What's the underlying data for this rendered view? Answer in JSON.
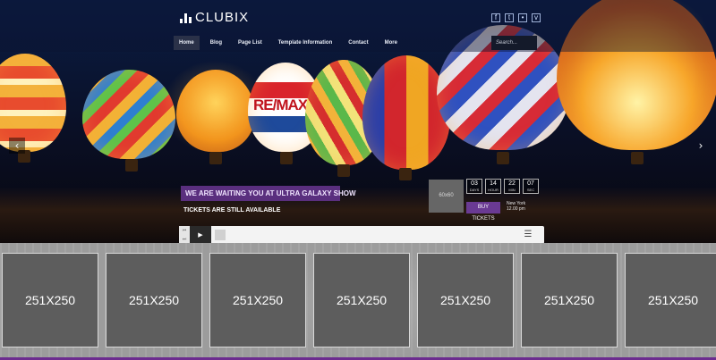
{
  "site": {
    "logo_text": "CLUBIX"
  },
  "nav": {
    "items": [
      "Home",
      "Blog",
      "Page List",
      "Template Information",
      "Contact",
      "More"
    ],
    "active": "Home"
  },
  "search": {
    "placeholder": "Search..."
  },
  "social": {
    "icons": [
      "facebook-icon",
      "twitter-icon",
      "flickr-icon",
      "vimeo-icon"
    ]
  },
  "hero": {
    "balloon_text": "RE/MAX",
    "banner_title": "WE ARE WAITING YOU AT ULTRA GALAXY SHOW",
    "subtitle": "TICKETS ARE STILL AVAILABLE",
    "thumb_label": "60x60",
    "countdown": [
      {
        "value": "03",
        "unit": "DAYS"
      },
      {
        "value": "14",
        "unit": "HOUR"
      },
      {
        "value": "22",
        "unit": "MIN"
      },
      {
        "value": "07",
        "unit": "SEC"
      }
    ],
    "buy_label": "BUY TICKETS",
    "event_city": "New York",
    "event_time": "12.00 pm"
  },
  "gallery": {
    "tiles": [
      "251X250",
      "251X250",
      "251X250",
      "251X250",
      "251X250",
      "251X250",
      "251X250"
    ]
  },
  "colors": {
    "accent": "#6a3a93",
    "banner": "#5a2f7e"
  }
}
